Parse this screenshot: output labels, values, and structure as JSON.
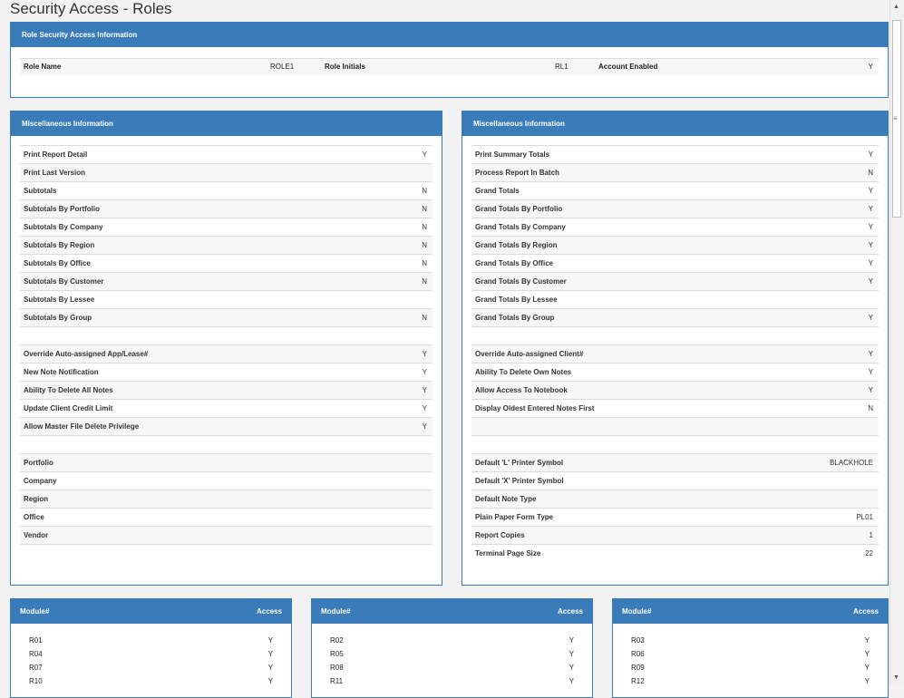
{
  "title": "Security Access - Roles",
  "role_panel": {
    "header": "Role Security Access Information",
    "role_name_label": "Role Name",
    "role_name_value": "ROLE1",
    "role_initials_label": "Role Initials",
    "role_initials_value": "RL1",
    "account_enabled_label": "Account Enabled",
    "account_enabled_value": "Y"
  },
  "misc_left": {
    "header": "Miscellaneous Information",
    "rows": [
      {
        "label": "Print Report Detail",
        "value": "Y"
      },
      {
        "label": "Print Last Version",
        "value": ""
      },
      {
        "label": "Subtotals",
        "value": "N"
      },
      {
        "label": "Subtotals By Portfolio",
        "value": "N"
      },
      {
        "label": "Subtotals By Company",
        "value": "N"
      },
      {
        "label": "Subtotals By Region",
        "value": "N"
      },
      {
        "label": "Subtotals By Office",
        "value": "N"
      },
      {
        "label": "Subtotals By Customer",
        "value": "N"
      },
      {
        "label": "Subtotals By Lessee",
        "value": ""
      },
      {
        "label": "Subtotals By Group",
        "value": "N"
      },
      {
        "label": "",
        "value": ""
      },
      {
        "label": "Override Auto-assigned App/Lease#",
        "value": "Y"
      },
      {
        "label": "New Note Notification",
        "value": "Y"
      },
      {
        "label": "Ability To Delete All Notes",
        "value": "Y"
      },
      {
        "label": "Update Client Credit Limit",
        "value": "Y"
      },
      {
        "label": "Allow Master File Delete Privilege",
        "value": "Y"
      },
      {
        "label": "",
        "value": ""
      },
      {
        "label": "Portfolio",
        "value": ""
      },
      {
        "label": "Company",
        "value": ""
      },
      {
        "label": "Region",
        "value": ""
      },
      {
        "label": "Office",
        "value": ""
      },
      {
        "label": "Vendor",
        "value": ""
      },
      {
        "label": "",
        "value": ""
      }
    ]
  },
  "misc_right": {
    "header": "Miscellaneous Information",
    "rows": [
      {
        "label": "Print Summary Totals",
        "value": "Y"
      },
      {
        "label": "Process Report In Batch",
        "value": "N"
      },
      {
        "label": "Grand Totals",
        "value": "Y"
      },
      {
        "label": "Grand Totals By Portfolio",
        "value": "Y"
      },
      {
        "label": "Grand Totals By Company",
        "value": "Y"
      },
      {
        "label": "Grand Totals By Region",
        "value": "Y"
      },
      {
        "label": "Grand Totals By Office",
        "value": "Y"
      },
      {
        "label": "Grand Totals By Customer",
        "value": "Y"
      },
      {
        "label": "Grand Totals By Lessee",
        "value": ""
      },
      {
        "label": "Grand Totals By Group",
        "value": "Y"
      },
      {
        "label": "",
        "value": ""
      },
      {
        "label": "Override Auto-assigned Client#",
        "value": "Y"
      },
      {
        "label": "Ability To Delete Own Notes",
        "value": "Y"
      },
      {
        "label": "Allow Access To Notebook",
        "value": "Y"
      },
      {
        "label": "Display Oldest Entered Notes First",
        "value": "N"
      },
      {
        "label": "",
        "value": ""
      },
      {
        "label": "",
        "value": ""
      },
      {
        "label": "Default 'L' Printer Symbol",
        "value": "BLACKHOLE"
      },
      {
        "label": "Default 'X' Printer Symbol",
        "value": ""
      },
      {
        "label": "Default Note Type",
        "value": ""
      },
      {
        "label": "Plain Paper Form Type",
        "value": "PL01"
      },
      {
        "label": "Report Copies",
        "value": "1"
      },
      {
        "label": "Terminal Page Size",
        "value": "22"
      }
    ]
  },
  "modules": [
    {
      "header_module": "Module#",
      "header_access": "Access",
      "items": [
        {
          "m": "R01",
          "a": "Y"
        },
        {
          "m": "R04",
          "a": "Y"
        },
        {
          "m": "R07",
          "a": "Y"
        },
        {
          "m": "R10",
          "a": "Y"
        }
      ]
    },
    {
      "header_module": "Module#",
      "header_access": "Access",
      "items": [
        {
          "m": "R02",
          "a": "Y"
        },
        {
          "m": "R05",
          "a": "Y"
        },
        {
          "m": "R08",
          "a": "Y"
        },
        {
          "m": "R11",
          "a": "Y"
        }
      ]
    },
    {
      "header_module": "Module#",
      "header_access": "Access",
      "items": [
        {
          "m": "R03",
          "a": "Y"
        },
        {
          "m": "R06",
          "a": "Y"
        },
        {
          "m": "R09",
          "a": "Y"
        },
        {
          "m": "R12",
          "a": "Y"
        }
      ]
    }
  ],
  "scrollbar": {
    "up_icon": "scroll-up-arrow-icon",
    "down_icon": "scroll-down-arrow-icon",
    "grip_icon": "scroll-grip-icon",
    "grip_glyph": "≡",
    "up_glyph": "▲",
    "down_glyph": "▼"
  }
}
